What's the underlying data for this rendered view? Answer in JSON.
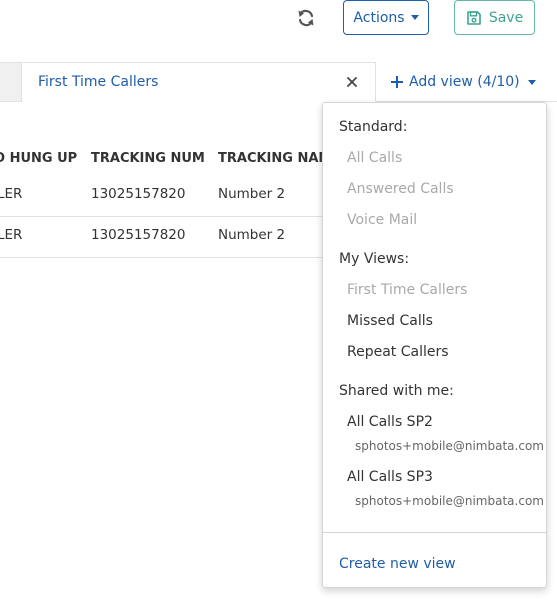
{
  "toolbar": {
    "refresh_icon": "refresh-icon",
    "actions_label": "Actions",
    "save_label": "Save",
    "save_icon": "save-icon"
  },
  "tabs": {
    "active_tab_label": "First Time Callers",
    "add_view_label": "Add view (4/10)"
  },
  "table": {
    "headers": [
      "O HUNG UP",
      "TRACKING NUM",
      "TRACKING NAM"
    ],
    "rows": [
      [
        "LER",
        "13025157820",
        "Number 2"
      ],
      [
        "LER",
        "13025157820",
        "Number 2"
      ]
    ]
  },
  "dropdown": {
    "standard_header": "Standard:",
    "standard_items": [
      "All Calls",
      "Answered Calls",
      "Voice Mail"
    ],
    "my_views_header": "My Views:",
    "my_views_items": [
      {
        "label": "First Time Callers",
        "disabled": true
      },
      {
        "label": "Missed Calls",
        "disabled": false
      },
      {
        "label": "Repeat Callers",
        "disabled": false
      }
    ],
    "shared_header": "Shared with me:",
    "shared_items": [
      {
        "label": "All Calls SP2",
        "owner": "sphotos+mobile@nimbata.com"
      },
      {
        "label": "All Calls SP3",
        "owner": "sphotos+mobile@nimbata.com"
      }
    ],
    "create_label": "Create new view"
  },
  "colors": {
    "primary": "#1f5ea8",
    "success": "#3fa58f",
    "disabled_text": "#a9a9a9"
  }
}
